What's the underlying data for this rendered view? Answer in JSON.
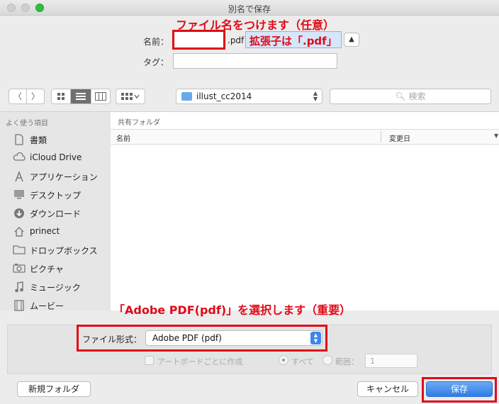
{
  "window": {
    "title": "別名で保存"
  },
  "annotations": {
    "filename_note": "ファイル名をつけます（任意）",
    "extension_note": "拡張子は「.pdf」",
    "format_note": "「Adobe PDF(pdf)」を選択します（重要）"
  },
  "form": {
    "name_label": "名前：",
    "name_value": "",
    "extension": ".pdf",
    "tag_label": "タグ：",
    "tag_value": ""
  },
  "toolbar": {
    "back": "〈",
    "forward": "〉",
    "location": "illust_cc2014",
    "search_placeholder": "検索"
  },
  "sidebar": {
    "header": "よく使う項目",
    "items": [
      {
        "label": "書類",
        "icon": "document-icon"
      },
      {
        "label": "iCloud Drive",
        "icon": "cloud-icon"
      },
      {
        "label": "アプリケーション",
        "icon": "applications-icon"
      },
      {
        "label": "デスクトップ",
        "icon": "desktop-icon"
      },
      {
        "label": "ダウンロード",
        "icon": "download-icon"
      },
      {
        "label": "prinect",
        "icon": "home-icon"
      },
      {
        "label": "ドロップボックス",
        "icon": "folder-icon"
      },
      {
        "label": "ピクチャ",
        "icon": "camera-icon"
      },
      {
        "label": "ミュージック",
        "icon": "music-icon"
      },
      {
        "label": "ムービー",
        "icon": "film-icon"
      }
    ]
  },
  "file_list": {
    "path": "共有フォルダ",
    "columns": {
      "name": "名前",
      "modified": "変更日"
    }
  },
  "options": {
    "format_label": "ファイル形式：",
    "format_value": "Adobe PDF (pdf)",
    "artboard_label": "アートボードごとに作成",
    "all_label": "すべて",
    "range_label": "範囲：",
    "range_value": "1"
  },
  "buttons": {
    "new_folder": "新規フォルダ",
    "cancel": "キャンセル",
    "save": "保存"
  },
  "colors": {
    "annotation": "#e00a17",
    "accent": "#3f86e8"
  }
}
